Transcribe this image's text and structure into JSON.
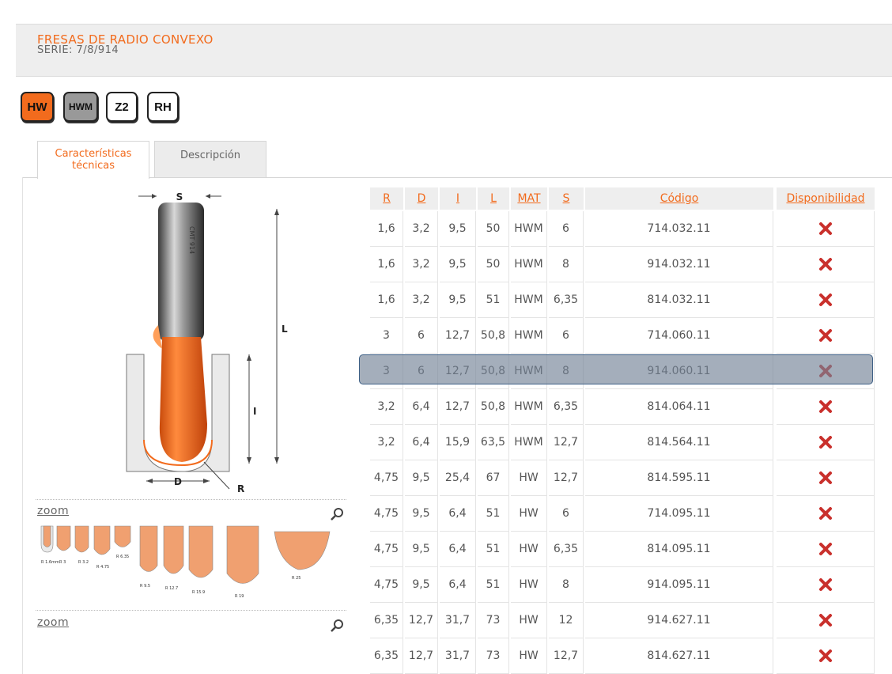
{
  "header": {
    "title": "FRESAS DE RADIO CONVEXO",
    "serie": "SERIE: 7/8/914"
  },
  "badges": [
    "HW",
    "HWM",
    "Z2",
    "RH"
  ],
  "tabs": {
    "active": "Características técnicas",
    "inactive": "Descripción"
  },
  "zoom": {
    "label1": "zoom",
    "label2": "zoom"
  },
  "drawing": {
    "s": "S",
    "l": "L",
    "i": "I",
    "d": "D",
    "r": "R"
  },
  "colors": {
    "accent": "#f26b1d",
    "header_bg": "#eeeeee",
    "error": "#c9302c",
    "highlight": "#73829a"
  },
  "table": {
    "headers": [
      "R",
      "D",
      "I",
      "L",
      "MAT",
      "S",
      "Código",
      "Disponibilidad"
    ],
    "rows": [
      [
        "1,6",
        "3,2",
        "9,5",
        "50",
        "HWM",
        "6",
        "714.032.11"
      ],
      [
        "1,6",
        "3,2",
        "9,5",
        "50",
        "HWM",
        "8",
        "914.032.11"
      ],
      [
        "1,6",
        "3,2",
        "9,5",
        "51",
        "HWM",
        "6,35",
        "814.032.11"
      ],
      [
        "3",
        "6",
        "12,7",
        "50,8",
        "HWM",
        "6",
        "714.060.11"
      ],
      [
        "3",
        "6",
        "12,7",
        "50,8",
        "HWM",
        "8",
        "914.060.11"
      ],
      [
        "3,2",
        "6,4",
        "12,7",
        "50,8",
        "HWM",
        "6,35",
        "814.064.11"
      ],
      [
        "3,2",
        "6,4",
        "15,9",
        "63,5",
        "HWM",
        "12,7",
        "814.564.11"
      ],
      [
        "4,75",
        "9,5",
        "25,4",
        "67",
        "HW",
        "12,7",
        "814.595.11"
      ],
      [
        "4,75",
        "9,5",
        "6,4",
        "51",
        "HW",
        "6",
        "714.095.11"
      ],
      [
        "4,75",
        "9,5",
        "6,4",
        "51",
        "HW",
        "6,35",
        "814.095.11"
      ],
      [
        "4,75",
        "9,5",
        "6,4",
        "51",
        "HW",
        "8",
        "914.095.11"
      ],
      [
        "6,35",
        "12,7",
        "31,7",
        "73",
        "HW",
        "12",
        "914.627.11"
      ],
      [
        "6,35",
        "12,7",
        "31,7",
        "73",
        "HW",
        "12,7",
        "814.627.11"
      ]
    ],
    "availability_icon": "x-mark-icon",
    "highlighted_row": 4
  }
}
